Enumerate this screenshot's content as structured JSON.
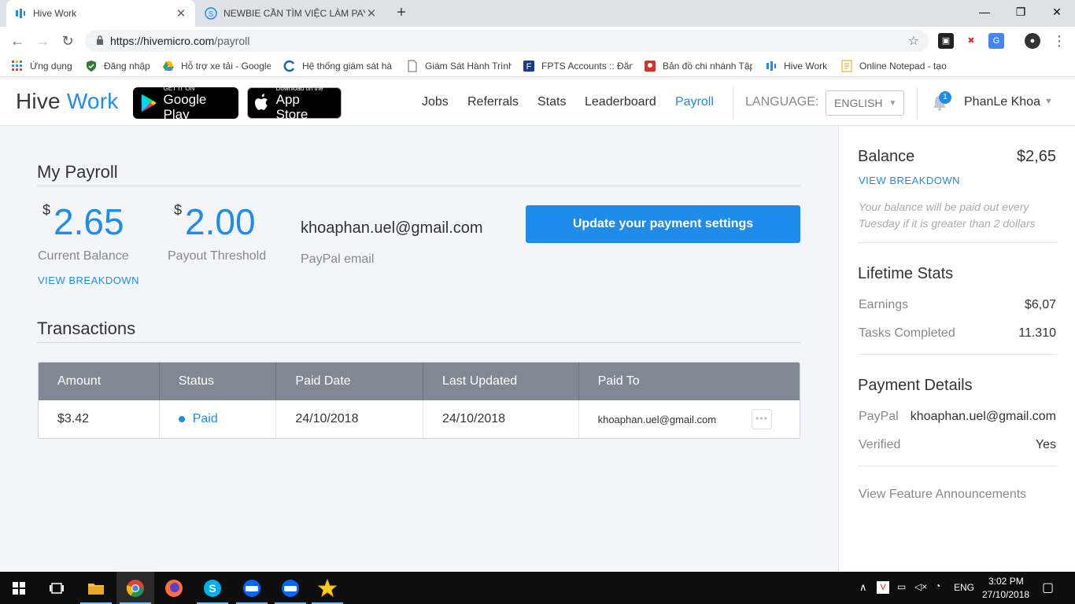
{
  "browser": {
    "tabs": [
      {
        "title": "Hive Work",
        "active": true
      },
      {
        "title": "NEWBIE CẦN TÌM VIỆC LÀM PAY",
        "active": false
      }
    ],
    "url_host": "https://hivemicro.com",
    "url_path": "/payroll",
    "bookmarks": [
      {
        "label": "Ứng dụng",
        "icon": "apps-grid-icon"
      },
      {
        "label": "Đăng nhập",
        "icon": "shield-icon"
      },
      {
        "label": "Hỗ trợ xe tải - Google",
        "icon": "google-drive-icon"
      },
      {
        "label": "Hệ thống giám sát hà",
        "icon": "globe-icon"
      },
      {
        "label": "Giám Sát Hành Trình",
        "icon": "page-icon"
      },
      {
        "label": "FPTS Accounts :: Đăng",
        "icon": "fpts-icon"
      },
      {
        "label": "Bản đồ chi nhánh Tập",
        "icon": "map-pin-icon"
      },
      {
        "label": "Hive Work",
        "icon": "hive-icon"
      },
      {
        "label": "Online Notepad - tạo",
        "icon": "notepad-icon"
      }
    ]
  },
  "header": {
    "logo_part1": "Hive",
    "logo_part2": "Work",
    "google_play_small": "GET IT ON",
    "google_play_big": "Google Play",
    "app_store_small": "Download on the",
    "app_store_big": "App Store",
    "nav": [
      "Jobs",
      "Referrals",
      "Stats",
      "Leaderboard",
      "Payroll"
    ],
    "active_nav": "Payroll",
    "language_label": "LANGUAGE:",
    "language_value": "ENGLISH",
    "notification_count": "1",
    "username": "PhanLe Khoa"
  },
  "payroll": {
    "title": "My Payroll",
    "current_balance_currency": "$",
    "current_balance": "2.65",
    "current_balance_label": "Current Balance",
    "view_breakdown": "VIEW BREAKDOWN",
    "payout_threshold_currency": "$",
    "payout_threshold": "2.00",
    "payout_threshold_label": "Payout Threshold",
    "paypal_email": "khoaphan.uel@gmail.com",
    "paypal_email_label": "PayPal email",
    "update_button": "Update your payment settings"
  },
  "transactions": {
    "title": "Transactions",
    "columns": [
      "Amount",
      "Status",
      "Paid Date",
      "Last Updated",
      "Paid To"
    ],
    "rows": [
      {
        "amount": "$3.42",
        "status": "Paid",
        "paid_date": "24/10/2018",
        "last_updated": "24/10/2018",
        "paid_to": "khoaphan.uel@gmail.com",
        "more": "•••"
      }
    ]
  },
  "sidebar": {
    "balance_title": "Balance",
    "balance_value": "$2,65",
    "view_breakdown": "VIEW BREAKDOWN",
    "balance_note": "Your balance will be paid out every Tuesday if it is greater than 2 dollars",
    "lifetime_title": "Lifetime Stats",
    "earnings_label": "Earnings",
    "earnings_value": "$6,07",
    "tasks_label": "Tasks Completed",
    "tasks_value": "11.310",
    "payment_title": "Payment Details",
    "paypal_label": "PayPal",
    "paypal_value": "khoaphan.uel@gmail.com",
    "verified_label": "Verified",
    "verified_value": "Yes",
    "announcements_link": "View Feature Announcements"
  },
  "taskbar": {
    "language": "ENG",
    "time": "3:02 PM",
    "date": "27/10/2018"
  },
  "colors": {
    "accent": "#1f8ceb",
    "table_header": "#808893",
    "page_bg": "#f4f5f9"
  }
}
